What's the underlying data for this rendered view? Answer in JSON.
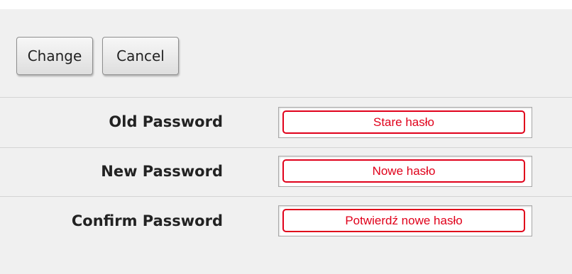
{
  "toolbar": {
    "change_label": "Change",
    "cancel_label": "Cancel"
  },
  "form": {
    "fields": [
      {
        "label": "Old Password",
        "value": "Stare hasło"
      },
      {
        "label": "New Password",
        "value": "Nowe hasło"
      },
      {
        "label": "Confirm Password",
        "value": "Potwierdź nowe hasło"
      }
    ]
  },
  "colors": {
    "annotation_red": "#e0001a",
    "panel_background": "#f0f0f0"
  }
}
